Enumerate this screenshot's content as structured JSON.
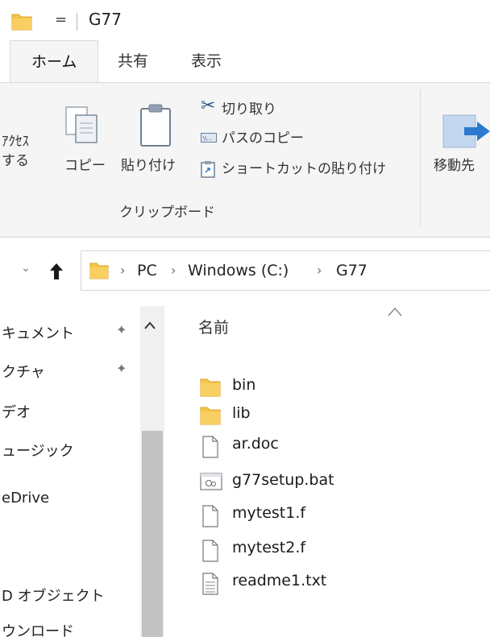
{
  "window": {
    "title": "G77",
    "quick_access_arrow": "="
  },
  "ribbon_tabs": [
    {
      "label": "ホーム",
      "active": true
    },
    {
      "label": "共有",
      "active": false
    },
    {
      "label": "表示",
      "active": false
    }
  ],
  "ribbon": {
    "pin_access_line1": "ｱｸｾｽ",
    "pin_access_line2": "する",
    "copy": "コピー",
    "paste": "貼り付け",
    "cut": "切り取り",
    "copy_path": "パスのコピー",
    "paste_shortcut": "ショートカットの貼り付け",
    "group_label": "クリップボード",
    "move_to": "移動先"
  },
  "address": {
    "crumbs": [
      "PC",
      "Windows (C:)",
      "G77"
    ]
  },
  "nav_pane": {
    "items": [
      "キュメント",
      "クチャ",
      "デオ",
      "ュージック",
      "eDrive",
      "D オブジェクト",
      "ウンロード"
    ]
  },
  "file_list": {
    "column_name": "名前",
    "items": [
      {
        "name": "bin",
        "icon": "folder-icon"
      },
      {
        "name": "lib",
        "icon": "folder-icon"
      },
      {
        "name": "ar.doc",
        "icon": "file-icon"
      },
      {
        "name": "g77setup.bat",
        "icon": "batch-file-icon"
      },
      {
        "name": "mytest1.f",
        "icon": "file-icon"
      },
      {
        "name": "mytest2.f",
        "icon": "file-icon"
      },
      {
        "name": "readme1.txt",
        "icon": "text-file-icon"
      }
    ]
  },
  "colors": {
    "folder": "#f6c549",
    "accent": "#2b79d0"
  }
}
